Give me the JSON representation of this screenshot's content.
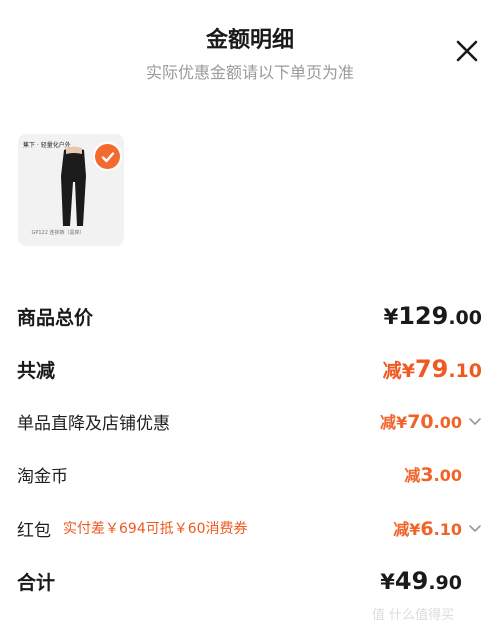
{
  "header": {
    "title": "金额明细",
    "subtitle": "实际优惠金额请以下单页为准",
    "close_icon": "close-icon"
  },
  "product": {
    "brand_text": "蕉下 · 轻量化户外",
    "caption": "GP122 连袜裤（黑棉）",
    "selected": true,
    "accent_color": "#f36a2e"
  },
  "rows": {
    "total": {
      "label": "商品总价",
      "currency": "¥",
      "int": "129",
      "dec": ".00"
    },
    "discount": {
      "label": "共减",
      "prefix": "减",
      "currency": "¥",
      "int": "79",
      "dec": ".10"
    },
    "shop_discount": {
      "label": "单品直降及店铺优惠",
      "prefix": "减",
      "currency": "¥",
      "int": "70",
      "dec": ".00"
    },
    "coins": {
      "label": "淘金币",
      "prefix": "减",
      "currency": "",
      "int": "3",
      "dec": ".00"
    },
    "red_packet": {
      "label": "红包",
      "note": "实付差￥694可抵￥60消费券",
      "prefix": "减",
      "currency": "¥",
      "int": "6",
      "dec": ".10"
    },
    "sum": {
      "label": "合计",
      "currency": "¥",
      "int": "49",
      "dec": ".90"
    }
  },
  "watermark": "值 什么值得买",
  "colors": {
    "accent": "#ef5a22",
    "text": "#1a1a1a",
    "muted": "#9a9a9a"
  }
}
